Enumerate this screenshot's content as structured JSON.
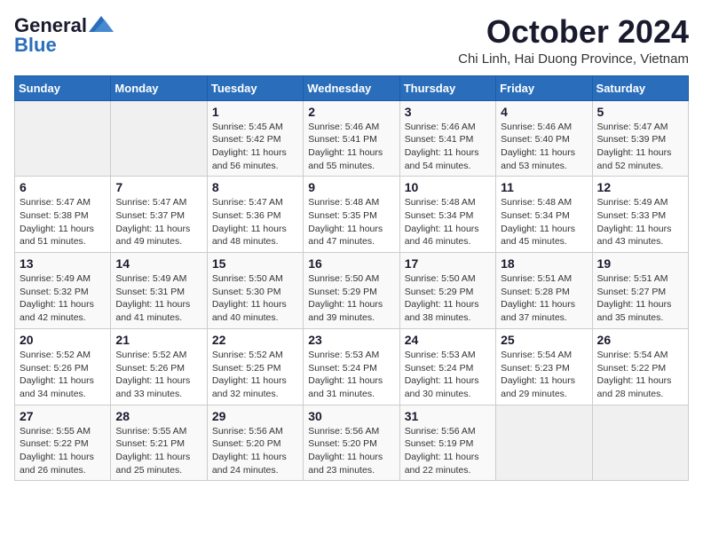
{
  "header": {
    "logo_line1": "General",
    "logo_line2": "Blue",
    "month": "October 2024",
    "location": "Chi Linh, Hai Duong Province, Vietnam"
  },
  "weekdays": [
    "Sunday",
    "Monday",
    "Tuesday",
    "Wednesday",
    "Thursday",
    "Friday",
    "Saturday"
  ],
  "weeks": [
    [
      {
        "day": "",
        "detail": ""
      },
      {
        "day": "",
        "detail": ""
      },
      {
        "day": "1",
        "detail": "Sunrise: 5:45 AM\nSunset: 5:42 PM\nDaylight: 11 hours\nand 56 minutes."
      },
      {
        "day": "2",
        "detail": "Sunrise: 5:46 AM\nSunset: 5:41 PM\nDaylight: 11 hours\nand 55 minutes."
      },
      {
        "day": "3",
        "detail": "Sunrise: 5:46 AM\nSunset: 5:41 PM\nDaylight: 11 hours\nand 54 minutes."
      },
      {
        "day": "4",
        "detail": "Sunrise: 5:46 AM\nSunset: 5:40 PM\nDaylight: 11 hours\nand 53 minutes."
      },
      {
        "day": "5",
        "detail": "Sunrise: 5:47 AM\nSunset: 5:39 PM\nDaylight: 11 hours\nand 52 minutes."
      }
    ],
    [
      {
        "day": "6",
        "detail": "Sunrise: 5:47 AM\nSunset: 5:38 PM\nDaylight: 11 hours\nand 51 minutes."
      },
      {
        "day": "7",
        "detail": "Sunrise: 5:47 AM\nSunset: 5:37 PM\nDaylight: 11 hours\nand 49 minutes."
      },
      {
        "day": "8",
        "detail": "Sunrise: 5:47 AM\nSunset: 5:36 PM\nDaylight: 11 hours\nand 48 minutes."
      },
      {
        "day": "9",
        "detail": "Sunrise: 5:48 AM\nSunset: 5:35 PM\nDaylight: 11 hours\nand 47 minutes."
      },
      {
        "day": "10",
        "detail": "Sunrise: 5:48 AM\nSunset: 5:34 PM\nDaylight: 11 hours\nand 46 minutes."
      },
      {
        "day": "11",
        "detail": "Sunrise: 5:48 AM\nSunset: 5:34 PM\nDaylight: 11 hours\nand 45 minutes."
      },
      {
        "day": "12",
        "detail": "Sunrise: 5:49 AM\nSunset: 5:33 PM\nDaylight: 11 hours\nand 43 minutes."
      }
    ],
    [
      {
        "day": "13",
        "detail": "Sunrise: 5:49 AM\nSunset: 5:32 PM\nDaylight: 11 hours\nand 42 minutes."
      },
      {
        "day": "14",
        "detail": "Sunrise: 5:49 AM\nSunset: 5:31 PM\nDaylight: 11 hours\nand 41 minutes."
      },
      {
        "day": "15",
        "detail": "Sunrise: 5:50 AM\nSunset: 5:30 PM\nDaylight: 11 hours\nand 40 minutes."
      },
      {
        "day": "16",
        "detail": "Sunrise: 5:50 AM\nSunset: 5:29 PM\nDaylight: 11 hours\nand 39 minutes."
      },
      {
        "day": "17",
        "detail": "Sunrise: 5:50 AM\nSunset: 5:29 PM\nDaylight: 11 hours\nand 38 minutes."
      },
      {
        "day": "18",
        "detail": "Sunrise: 5:51 AM\nSunset: 5:28 PM\nDaylight: 11 hours\nand 37 minutes."
      },
      {
        "day": "19",
        "detail": "Sunrise: 5:51 AM\nSunset: 5:27 PM\nDaylight: 11 hours\nand 35 minutes."
      }
    ],
    [
      {
        "day": "20",
        "detail": "Sunrise: 5:52 AM\nSunset: 5:26 PM\nDaylight: 11 hours\nand 34 minutes."
      },
      {
        "day": "21",
        "detail": "Sunrise: 5:52 AM\nSunset: 5:26 PM\nDaylight: 11 hours\nand 33 minutes."
      },
      {
        "day": "22",
        "detail": "Sunrise: 5:52 AM\nSunset: 5:25 PM\nDaylight: 11 hours\nand 32 minutes."
      },
      {
        "day": "23",
        "detail": "Sunrise: 5:53 AM\nSunset: 5:24 PM\nDaylight: 11 hours\nand 31 minutes."
      },
      {
        "day": "24",
        "detail": "Sunrise: 5:53 AM\nSunset: 5:24 PM\nDaylight: 11 hours\nand 30 minutes."
      },
      {
        "day": "25",
        "detail": "Sunrise: 5:54 AM\nSunset: 5:23 PM\nDaylight: 11 hours\nand 29 minutes."
      },
      {
        "day": "26",
        "detail": "Sunrise: 5:54 AM\nSunset: 5:22 PM\nDaylight: 11 hours\nand 28 minutes."
      }
    ],
    [
      {
        "day": "27",
        "detail": "Sunrise: 5:55 AM\nSunset: 5:22 PM\nDaylight: 11 hours\nand 26 minutes."
      },
      {
        "day": "28",
        "detail": "Sunrise: 5:55 AM\nSunset: 5:21 PM\nDaylight: 11 hours\nand 25 minutes."
      },
      {
        "day": "29",
        "detail": "Sunrise: 5:56 AM\nSunset: 5:20 PM\nDaylight: 11 hours\nand 24 minutes."
      },
      {
        "day": "30",
        "detail": "Sunrise: 5:56 AM\nSunset: 5:20 PM\nDaylight: 11 hours\nand 23 minutes."
      },
      {
        "day": "31",
        "detail": "Sunrise: 5:56 AM\nSunset: 5:19 PM\nDaylight: 11 hours\nand 22 minutes."
      },
      {
        "day": "",
        "detail": ""
      },
      {
        "day": "",
        "detail": ""
      }
    ]
  ]
}
